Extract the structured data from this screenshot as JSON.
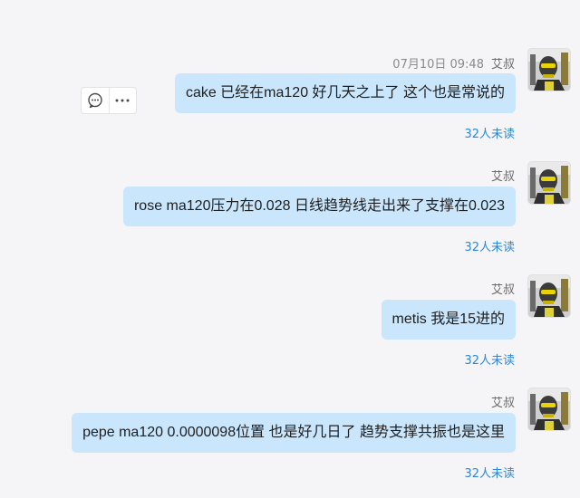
{
  "messages": [
    {
      "time": "07月10日 09:48",
      "sender": "艾叔",
      "text": "cake 已经在ma120 好几天之上了 这个也是常说的",
      "unread": "32人未读"
    },
    {
      "time": "",
      "sender": "艾叔",
      "text": "rose ma120压力在0.028  日线趋势线走出来了支撑在0.023",
      "unread": "32人未读"
    },
    {
      "time": "",
      "sender": "艾叔",
      "text": "metis 我是15进的",
      "unread": "32人未读"
    },
    {
      "time": "",
      "sender": "艾叔",
      "text": "pepe ma120 0.0000098位置 也是好几日了 趋势支撑共振也是这里",
      "unread": "32人未读"
    }
  ],
  "hover_actions": {
    "comment_icon": "comment-icon",
    "more_icon": "more-icon"
  }
}
